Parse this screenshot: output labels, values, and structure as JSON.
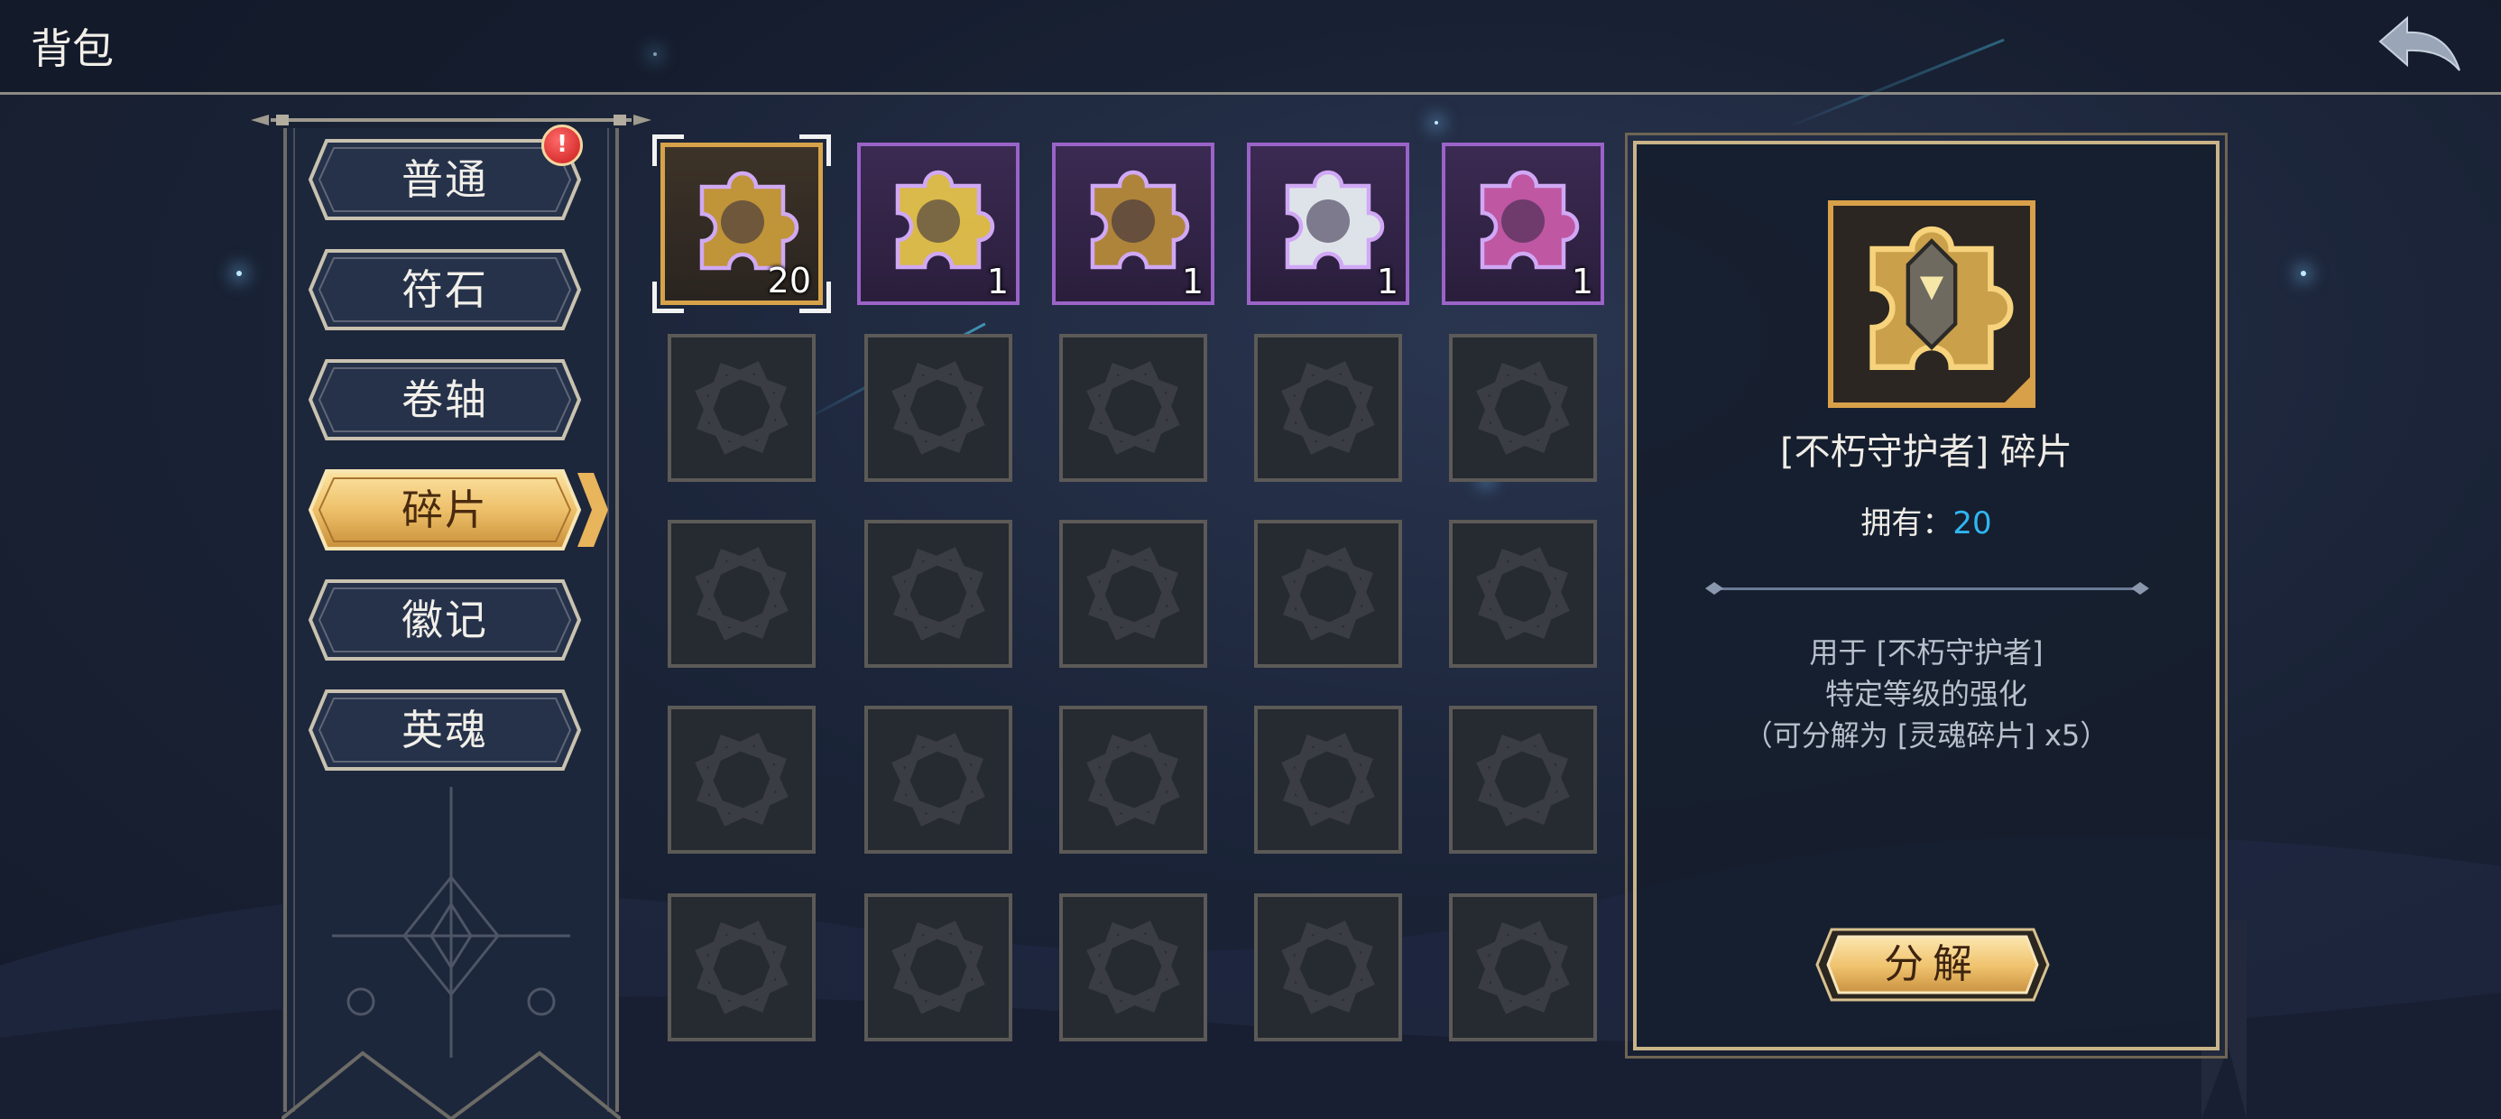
{
  "header": {
    "title": "背包"
  },
  "tabs": [
    {
      "label": "普通",
      "active": false,
      "has_alert": true,
      "alert_glyph": "!"
    },
    {
      "label": "符石",
      "active": false
    },
    {
      "label": "卷轴",
      "active": false
    },
    {
      "label": "碎片",
      "active": true
    },
    {
      "label": "徽记",
      "active": false
    },
    {
      "label": "英魂",
      "active": false
    }
  ],
  "inventory": {
    "items": [
      {
        "name": "不朽守护者碎片",
        "count": "20",
        "rarity": "gold",
        "selected": true,
        "hue": "#c89a3a"
      },
      {
        "name": "碎片",
        "count": "1",
        "rarity": "purple",
        "selected": false,
        "hue": "#e3c24a"
      },
      {
        "name": "碎片",
        "count": "1",
        "rarity": "purple",
        "selected": false,
        "hue": "#b58a3a"
      },
      {
        "name": "碎片",
        "count": "1",
        "rarity": "purple",
        "selected": false,
        "hue": "#e8eef2"
      },
      {
        "name": "碎片",
        "count": "1",
        "rarity": "purple",
        "selected": false,
        "hue": "#c75aa8"
      }
    ],
    "empty_slot_rows": 4,
    "columns": 5
  },
  "detail": {
    "name": "[不朽守护者] 碎片",
    "owned_label": "拥有：",
    "owned_value": "20",
    "description_lines": [
      "用于 [不朽守护者]",
      "特定等级的强化",
      "（可分解为 [灵魂碎片] x5）"
    ],
    "decompose_label": "分解"
  },
  "colors": {
    "accent_gold": "#e6b85a",
    "rare_purple": "#9a63c8",
    "owned_number": "#2fb6f2"
  }
}
